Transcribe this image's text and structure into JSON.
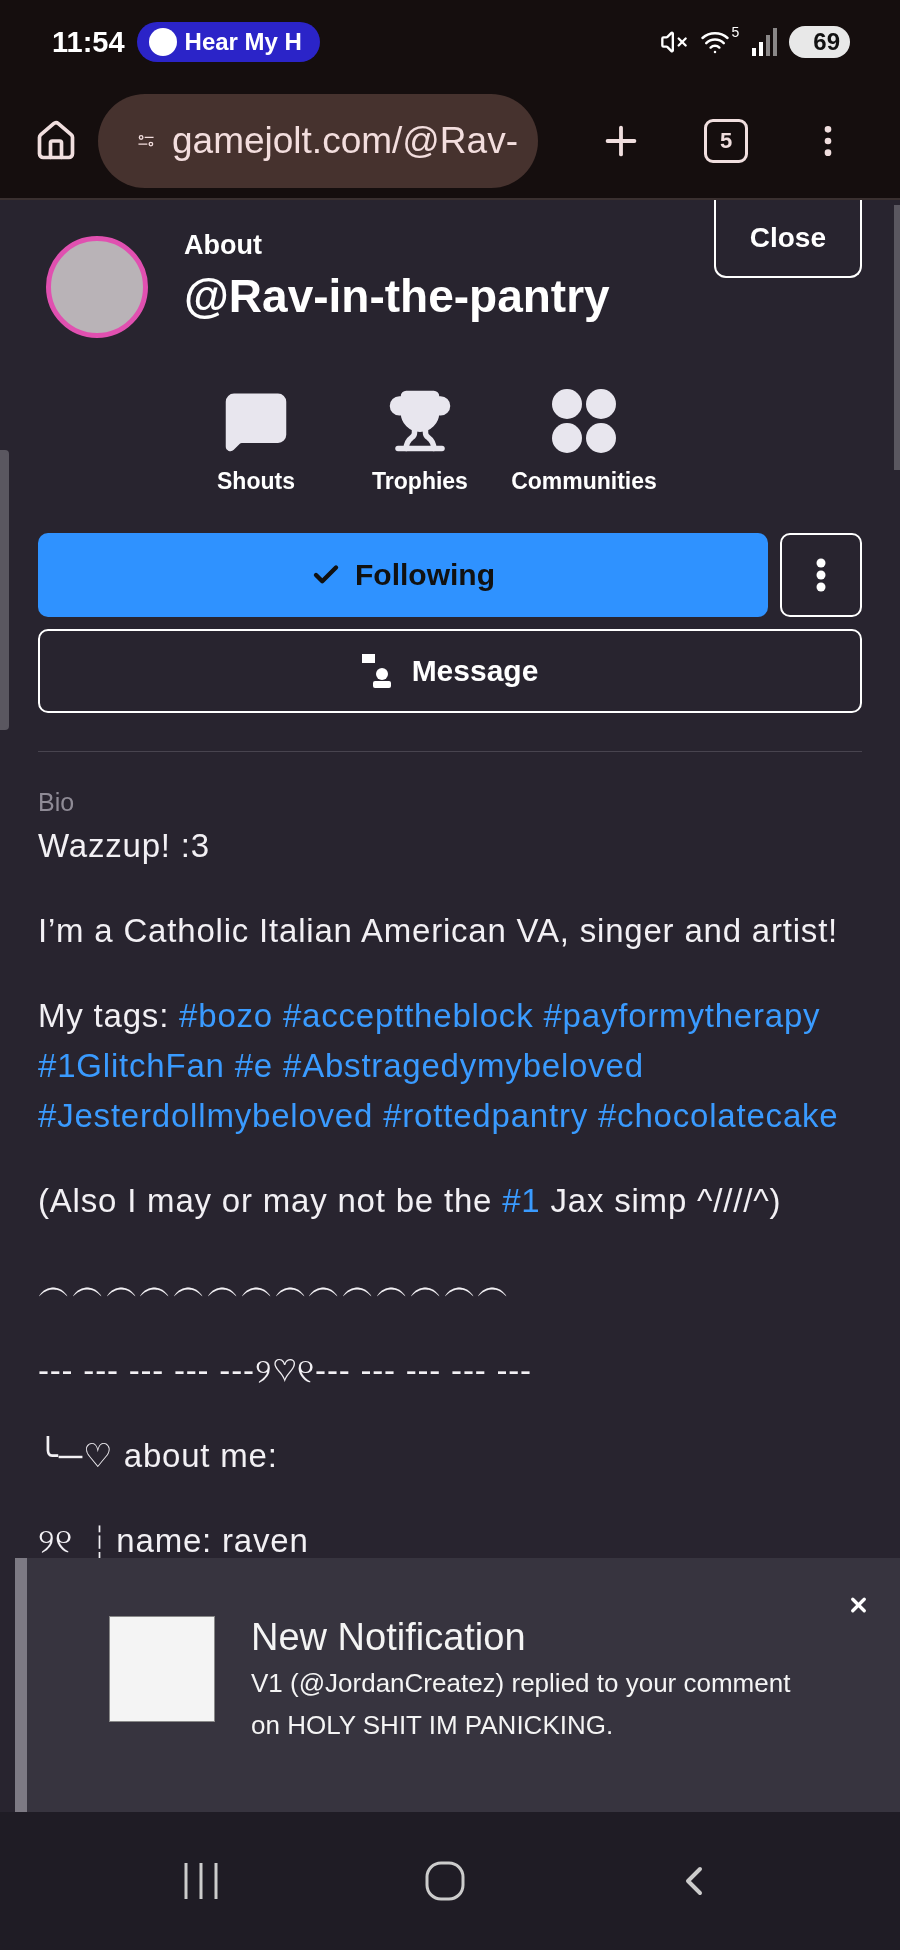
{
  "status_bar": {
    "time": "11:54",
    "media_pill": "Hear My H",
    "wifi_band": "5",
    "battery": "69"
  },
  "browser": {
    "url": "gamejolt.com/@Rav-",
    "tab_count": "5"
  },
  "profile": {
    "heading": "About",
    "username": "@Rav-in-the-pantry",
    "close": "Close"
  },
  "sections": [
    {
      "label": "Shouts",
      "kind": "shouts"
    },
    {
      "label": "Trophies",
      "kind": "trophies"
    },
    {
      "label": "Communities",
      "kind": "communities"
    }
  ],
  "follow_button": {
    "label": "Following",
    "following": true
  },
  "message_button": {
    "label": "Message"
  },
  "bio": {
    "label": "Bio",
    "paragraphs": [
      [
        {
          "text": "Wazzup! :3",
          "kind": "plain"
        }
      ],
      [
        {
          "text": "I’m a Catholic Italian American VA, singer and artist!",
          "kind": "plain"
        }
      ],
      [
        {
          "text": "My tags: ",
          "kind": "plain"
        },
        {
          "text": "#bozo",
          "kind": "tag"
        },
        {
          "text": "#accepttheblock",
          "kind": "tag"
        },
        {
          "text": "#payformytherapy",
          "kind": "tag"
        },
        {
          "text": "#1GlitchFan",
          "kind": "tag"
        },
        {
          "text": "#e",
          "kind": "tag"
        },
        {
          "text": "#Abstragedymybeloved",
          "kind": "tag"
        },
        {
          "text": "#Jesterdollmybeloved",
          "kind": "tag"
        },
        {
          "text": "#rottedpantry",
          "kind": "tag"
        },
        {
          "text": "#chocolatecake",
          "kind": "tag"
        }
      ],
      [
        {
          "text": "(Also I may or may not be the ",
          "kind": "plain"
        },
        {
          "text": "#1",
          "kind": "tag"
        },
        {
          "text": " Jax simp ^////^)",
          "kind": "plain"
        }
      ],
      [
        {
          "text": "︵︵︵︵︵︵︵︵︵︵︵︵︵︵",
          "kind": "plain"
        }
      ],
      [
        {
          "text": "--- --- --- --- ---୨♡୧--- --- --- --- ---",
          "kind": "plain"
        }
      ],
      [
        {
          "text": "╰─♡ about me:",
          "kind": "plain"
        }
      ],
      [
        {
          "text": "୨୧ ┆name: raven",
          "kind": "plain"
        }
      ]
    ]
  },
  "notification": {
    "title": "New Notification",
    "body": "V1 (@JordanCreatez) replied to your comment on HOLY SHIT IM PANICKING."
  }
}
